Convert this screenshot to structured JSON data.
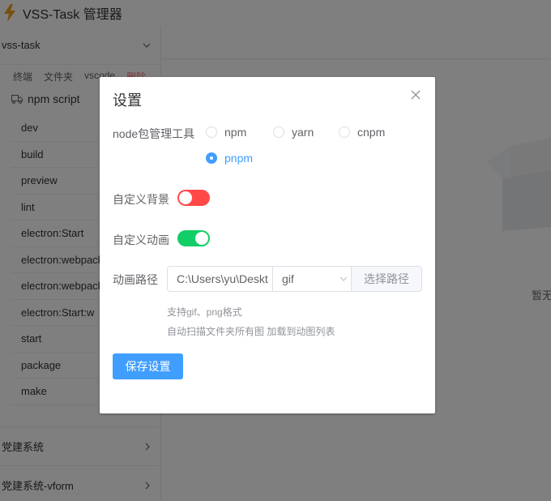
{
  "app": {
    "title": "VSS-Task 管理器"
  },
  "sidebar": {
    "group_title": "vss-task",
    "tabs": [
      "终端",
      "文件夹",
      "vscode",
      "删除"
    ],
    "script_header": "npm script",
    "scripts": [
      "dev",
      "build",
      "preview",
      "lint",
      "electron:Start",
      "electron:webpack",
      "electron:webpack",
      "electron:Start:w",
      "start",
      "package",
      "make"
    ],
    "other_groups": [
      "党建系统",
      "党建系统-vform"
    ]
  },
  "main": {
    "empty_text": "暂无"
  },
  "dialog": {
    "title": "设置",
    "pkg_manager": {
      "label": "node包管理工具",
      "options": [
        "npm",
        "yarn",
        "cnpm",
        "pnpm"
      ],
      "selected": "pnpm"
    },
    "custom_bg": {
      "label": "自定义背景",
      "enabled": false,
      "color": "#ff4949"
    },
    "custom_anim": {
      "label": "自定义动画",
      "enabled": true,
      "color": "#13ce66"
    },
    "anim_path": {
      "label": "动画路径",
      "path_value": "C:\\Users\\yu\\Deskt",
      "format_value": "gif",
      "choose_label": "选择路径"
    },
    "hint1": "支持gif、png格式",
    "hint2": "自动扫描文件夹所有图 加载到动图列表",
    "save_label": "保存设置"
  },
  "colors": {
    "primary": "#409eff",
    "danger": "#f56c6c"
  }
}
